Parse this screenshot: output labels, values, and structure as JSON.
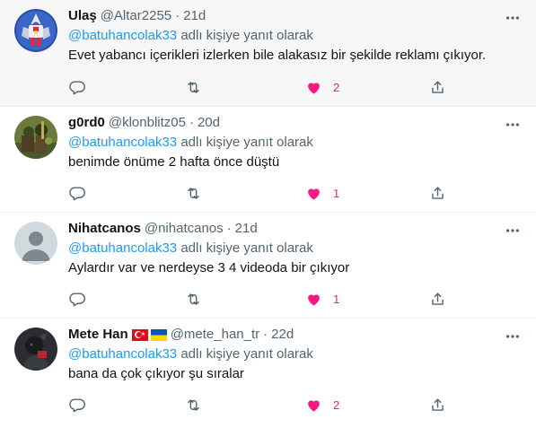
{
  "replies": [
    {
      "name": "Ulaş",
      "handle": "@Altar2255",
      "separator": "·",
      "time": "21d",
      "reply_mention": "@batuhancolak33",
      "reply_suffix": " adlı kişiye yanıt olarak",
      "text": "Evet yabancı içerikleri izlerken bile alakasız bir şekilde reklamı çıkıyor.",
      "likes": "2",
      "avatar_icon": "robot-avatar"
    },
    {
      "name": "g0rd0",
      "handle": "@klonblitz05",
      "separator": "·",
      "time": "20d",
      "reply_mention": "@batuhancolak33",
      "reply_suffix": " adlı kişiye yanıt olarak",
      "text": "benimde önüme 2 hafta önce düştü",
      "likes": "1",
      "avatar_icon": "soldier-avatar"
    },
    {
      "name": "Nihatcanos",
      "handle": "@nihatcanos",
      "separator": "·",
      "time": "21d",
      "reply_mention": "@batuhancolak33",
      "reply_suffix": " adlı kişiye yanıt olarak",
      "text": "Aylardır var ve nerdeyse 3 4 videoda bir çıkıyor",
      "likes": "1",
      "avatar_icon": "default-profile-avatar"
    },
    {
      "name": "Mete Han",
      "handle": "@mete_han_tr",
      "separator": "·",
      "time": "22d",
      "reply_mention": "@batuhancolak33",
      "reply_suffix": " adlı kişiye yanıt olarak",
      "text": "bana da çok çıkıyor şu sıralar",
      "likes": "2",
      "avatar_icon": "dark-character-avatar",
      "flags": [
        "turkey-flag",
        "ukraine-flag"
      ]
    }
  ],
  "colors": {
    "accent": "#1d9bf0",
    "like": "#f91880",
    "muted": "#536471",
    "highlight_bg": "#f7f7f7"
  }
}
